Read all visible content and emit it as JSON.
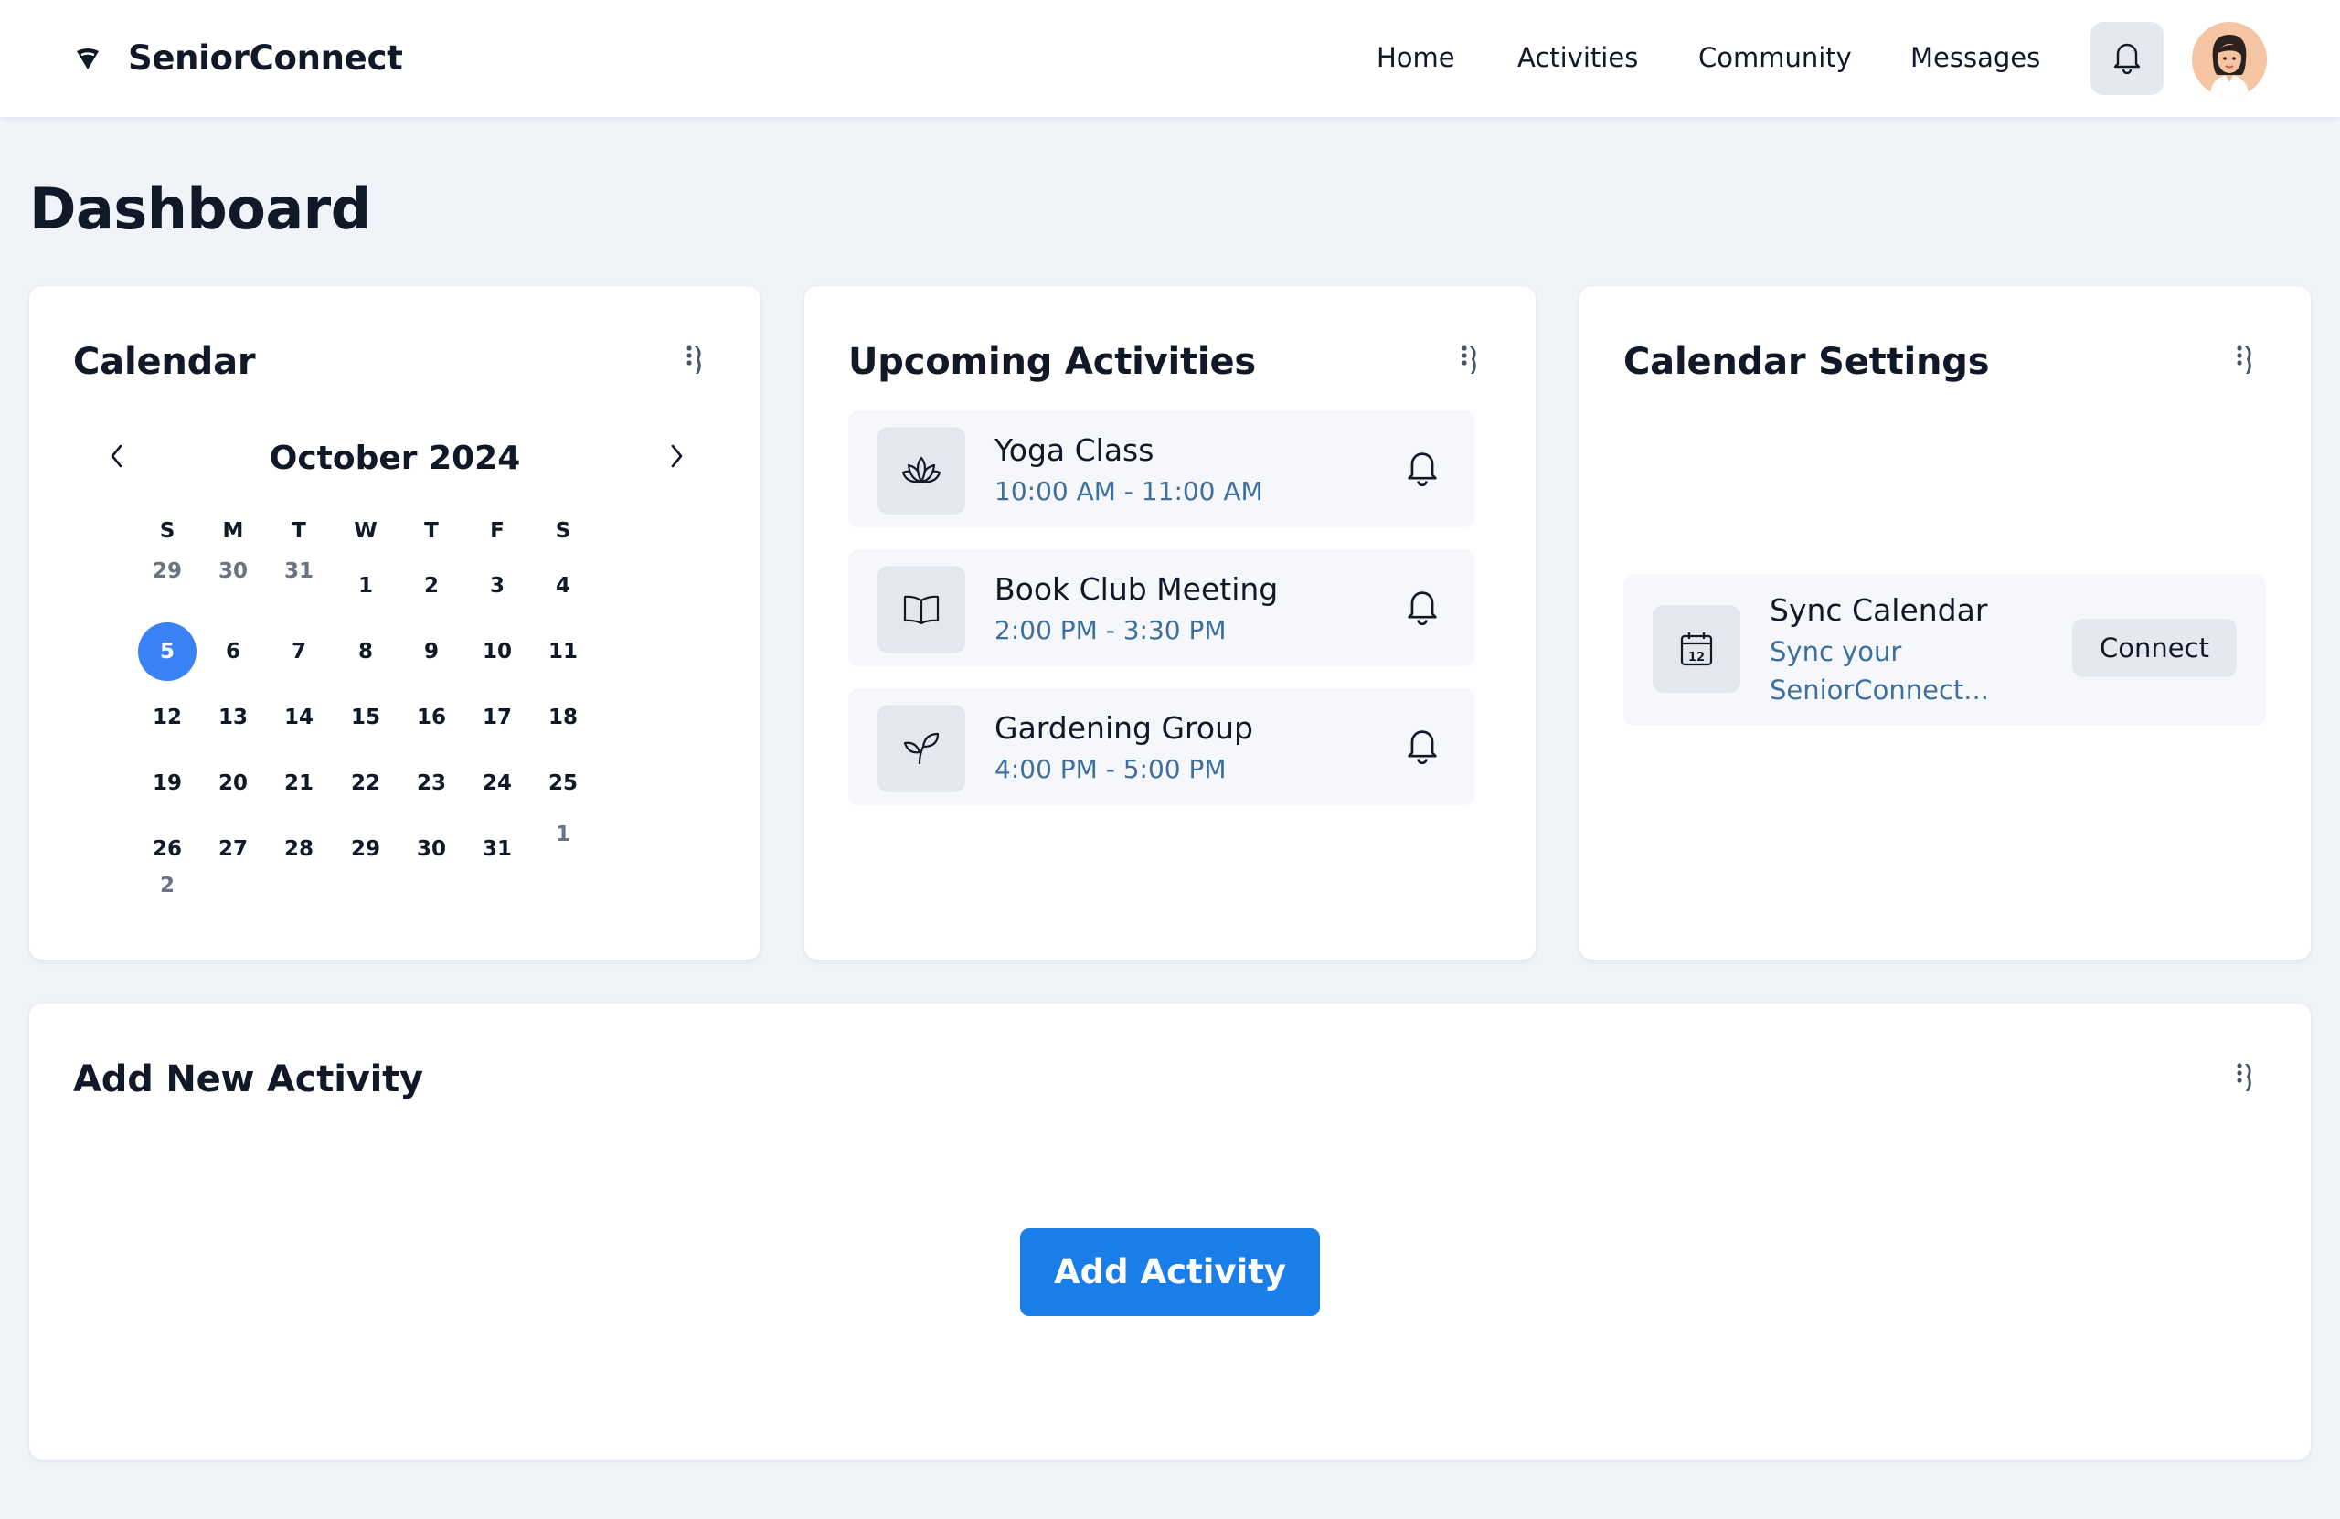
{
  "header": {
    "brand": "SeniorConnect",
    "nav": [
      "Home",
      "Activities",
      "Community",
      "Messages"
    ]
  },
  "page": {
    "title": "Dashboard"
  },
  "calendar": {
    "title": "Calendar",
    "month_label": "October 2024",
    "weekdays": [
      "S",
      "M",
      "T",
      "W",
      "T",
      "F",
      "S"
    ],
    "prev_days": [
      "29",
      "30",
      "31"
    ],
    "days": [
      "1",
      "2",
      "3",
      "4",
      "5",
      "6",
      "7",
      "8",
      "9",
      "10",
      "11",
      "12",
      "13",
      "14",
      "15",
      "16",
      "17",
      "18",
      "19",
      "20",
      "21",
      "22",
      "23",
      "24",
      "25",
      "26",
      "27",
      "28",
      "29",
      "30",
      "31"
    ],
    "next_days": [
      "1",
      "2"
    ],
    "selected_day": "5",
    "accent_color": "#3b82f6"
  },
  "activities": {
    "title": "Upcoming Activities",
    "items": [
      {
        "name": "Yoga Class",
        "time": "10:00 AM - 11:00 AM",
        "icon": "lotus-icon"
      },
      {
        "name": "Book Club Meeting",
        "time": "2:00 PM - 3:30 PM",
        "icon": "book-icon"
      },
      {
        "name": "Gardening Group",
        "time": "4:00 PM - 5:00 PM",
        "icon": "sprout-icon"
      }
    ]
  },
  "settings": {
    "title": "Calendar Settings",
    "sync": {
      "title": "Sync Calendar",
      "description": "Sync your SeniorConnect...",
      "button": "Connect",
      "icon": "calendar-icon"
    }
  },
  "add_activity": {
    "title": "Add New Activity",
    "button": "Add Activity",
    "button_color": "#1a7ee8"
  }
}
